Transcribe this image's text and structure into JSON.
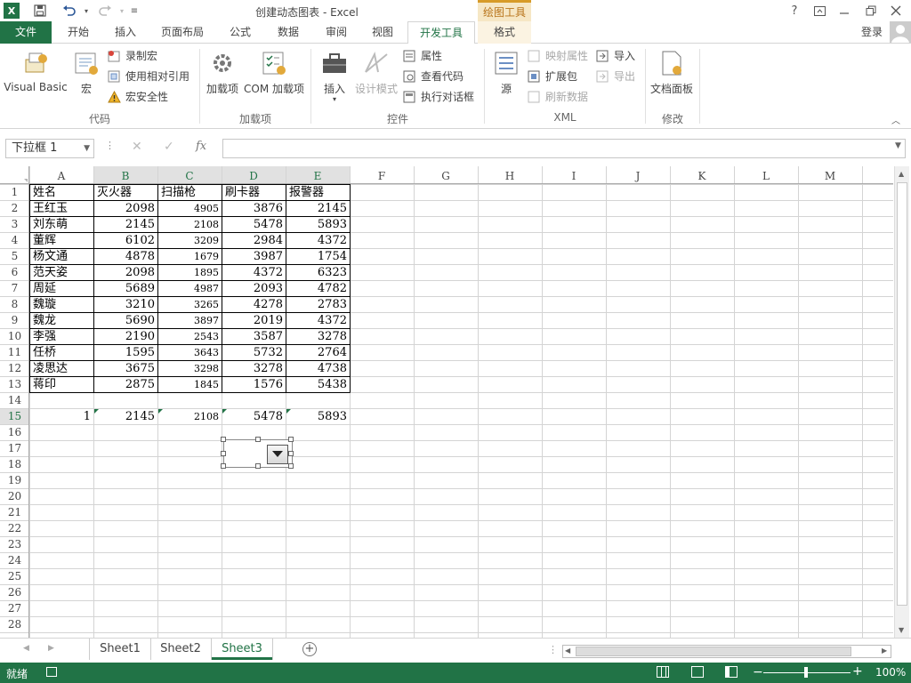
{
  "window": {
    "title": "创建动态图表 - Excel",
    "context_group": "绘图工具",
    "help": "?",
    "signin": "登录"
  },
  "tabs": {
    "file": "文件",
    "home": "开始",
    "insert": "插入",
    "layout": "页面布局",
    "formulas": "公式",
    "data": "数据",
    "review": "审阅",
    "view": "视图",
    "developer": "开发工具",
    "format": "格式"
  },
  "ribbon": {
    "visual_basic": "Visual Basic",
    "macros": "宏",
    "record_macro": "录制宏",
    "relative_ref": "使用相对引用",
    "macro_security": "宏安全性",
    "group_code": "代码",
    "addins": "加载项",
    "com_addins": "COM 加载项",
    "group_addins": "加载项",
    "insert": "插入",
    "design_mode": "设计模式",
    "properties": "属性",
    "view_code": "查看代码",
    "run_dialog": "执行对话框",
    "group_controls": "控件",
    "source": "源",
    "map_props": "映射属性",
    "expansion": "扩展包",
    "refresh": "刷新数据",
    "import": "导入",
    "export": "导出",
    "group_xml": "XML",
    "doc_panel": "文档面板",
    "group_modify": "修改"
  },
  "formula_bar": {
    "namebox": "下拉框 1",
    "fx": "fx",
    "formula": ""
  },
  "columns": [
    "A",
    "B",
    "C",
    "D",
    "E",
    "F",
    "G",
    "H",
    "I",
    "J",
    "K",
    "L",
    "M"
  ],
  "rows": [
    "1",
    "2",
    "3",
    "4",
    "5",
    "6",
    "7",
    "8",
    "9",
    "10",
    "11",
    "12",
    "13",
    "14",
    "15",
    "16",
    "17",
    "18",
    "19",
    "20",
    "21",
    "22",
    "23",
    "24",
    "25",
    "26",
    "27",
    "28"
  ],
  "table": {
    "header": [
      "姓名",
      "灭火器",
      "扫描枪",
      "刷卡器",
      "报警器"
    ],
    "rows": [
      [
        "王红玉",
        "2098",
        "4905",
        "3876",
        "2145"
      ],
      [
        "刘东萌",
        "2145",
        "2108",
        "5478",
        "5893"
      ],
      [
        "董辉",
        "6102",
        "3209",
        "2984",
        "4372"
      ],
      [
        "杨文通",
        "4878",
        "1679",
        "3987",
        "1754"
      ],
      [
        "范天姿",
        "2098",
        "1895",
        "4372",
        "6323"
      ],
      [
        "周延",
        "5689",
        "4987",
        "2093",
        "4782"
      ],
      [
        "魏璇",
        "3210",
        "3265",
        "4278",
        "2783"
      ],
      [
        "魏龙",
        "5690",
        "3897",
        "2019",
        "4372"
      ],
      [
        "李强",
        "2190",
        "2543",
        "3587",
        "3278"
      ],
      [
        "任桥",
        "1595",
        "3643",
        "5732",
        "2764"
      ],
      [
        "凌思达",
        "3675",
        "3298",
        "3278",
        "4738"
      ],
      [
        "蒋印",
        "2875",
        "1845",
        "1576",
        "5438"
      ]
    ]
  },
  "row15": [
    "1",
    "2145",
    "2108",
    "5478",
    "5893"
  ],
  "sheets": [
    "Sheet1",
    "Sheet2",
    "Sheet3"
  ],
  "active_sheet": "Sheet3",
  "status": {
    "ready": "就绪",
    "zoom": "100%"
  },
  "colors": {
    "excel_green": "#217346",
    "context_orange": "#d79b28"
  }
}
